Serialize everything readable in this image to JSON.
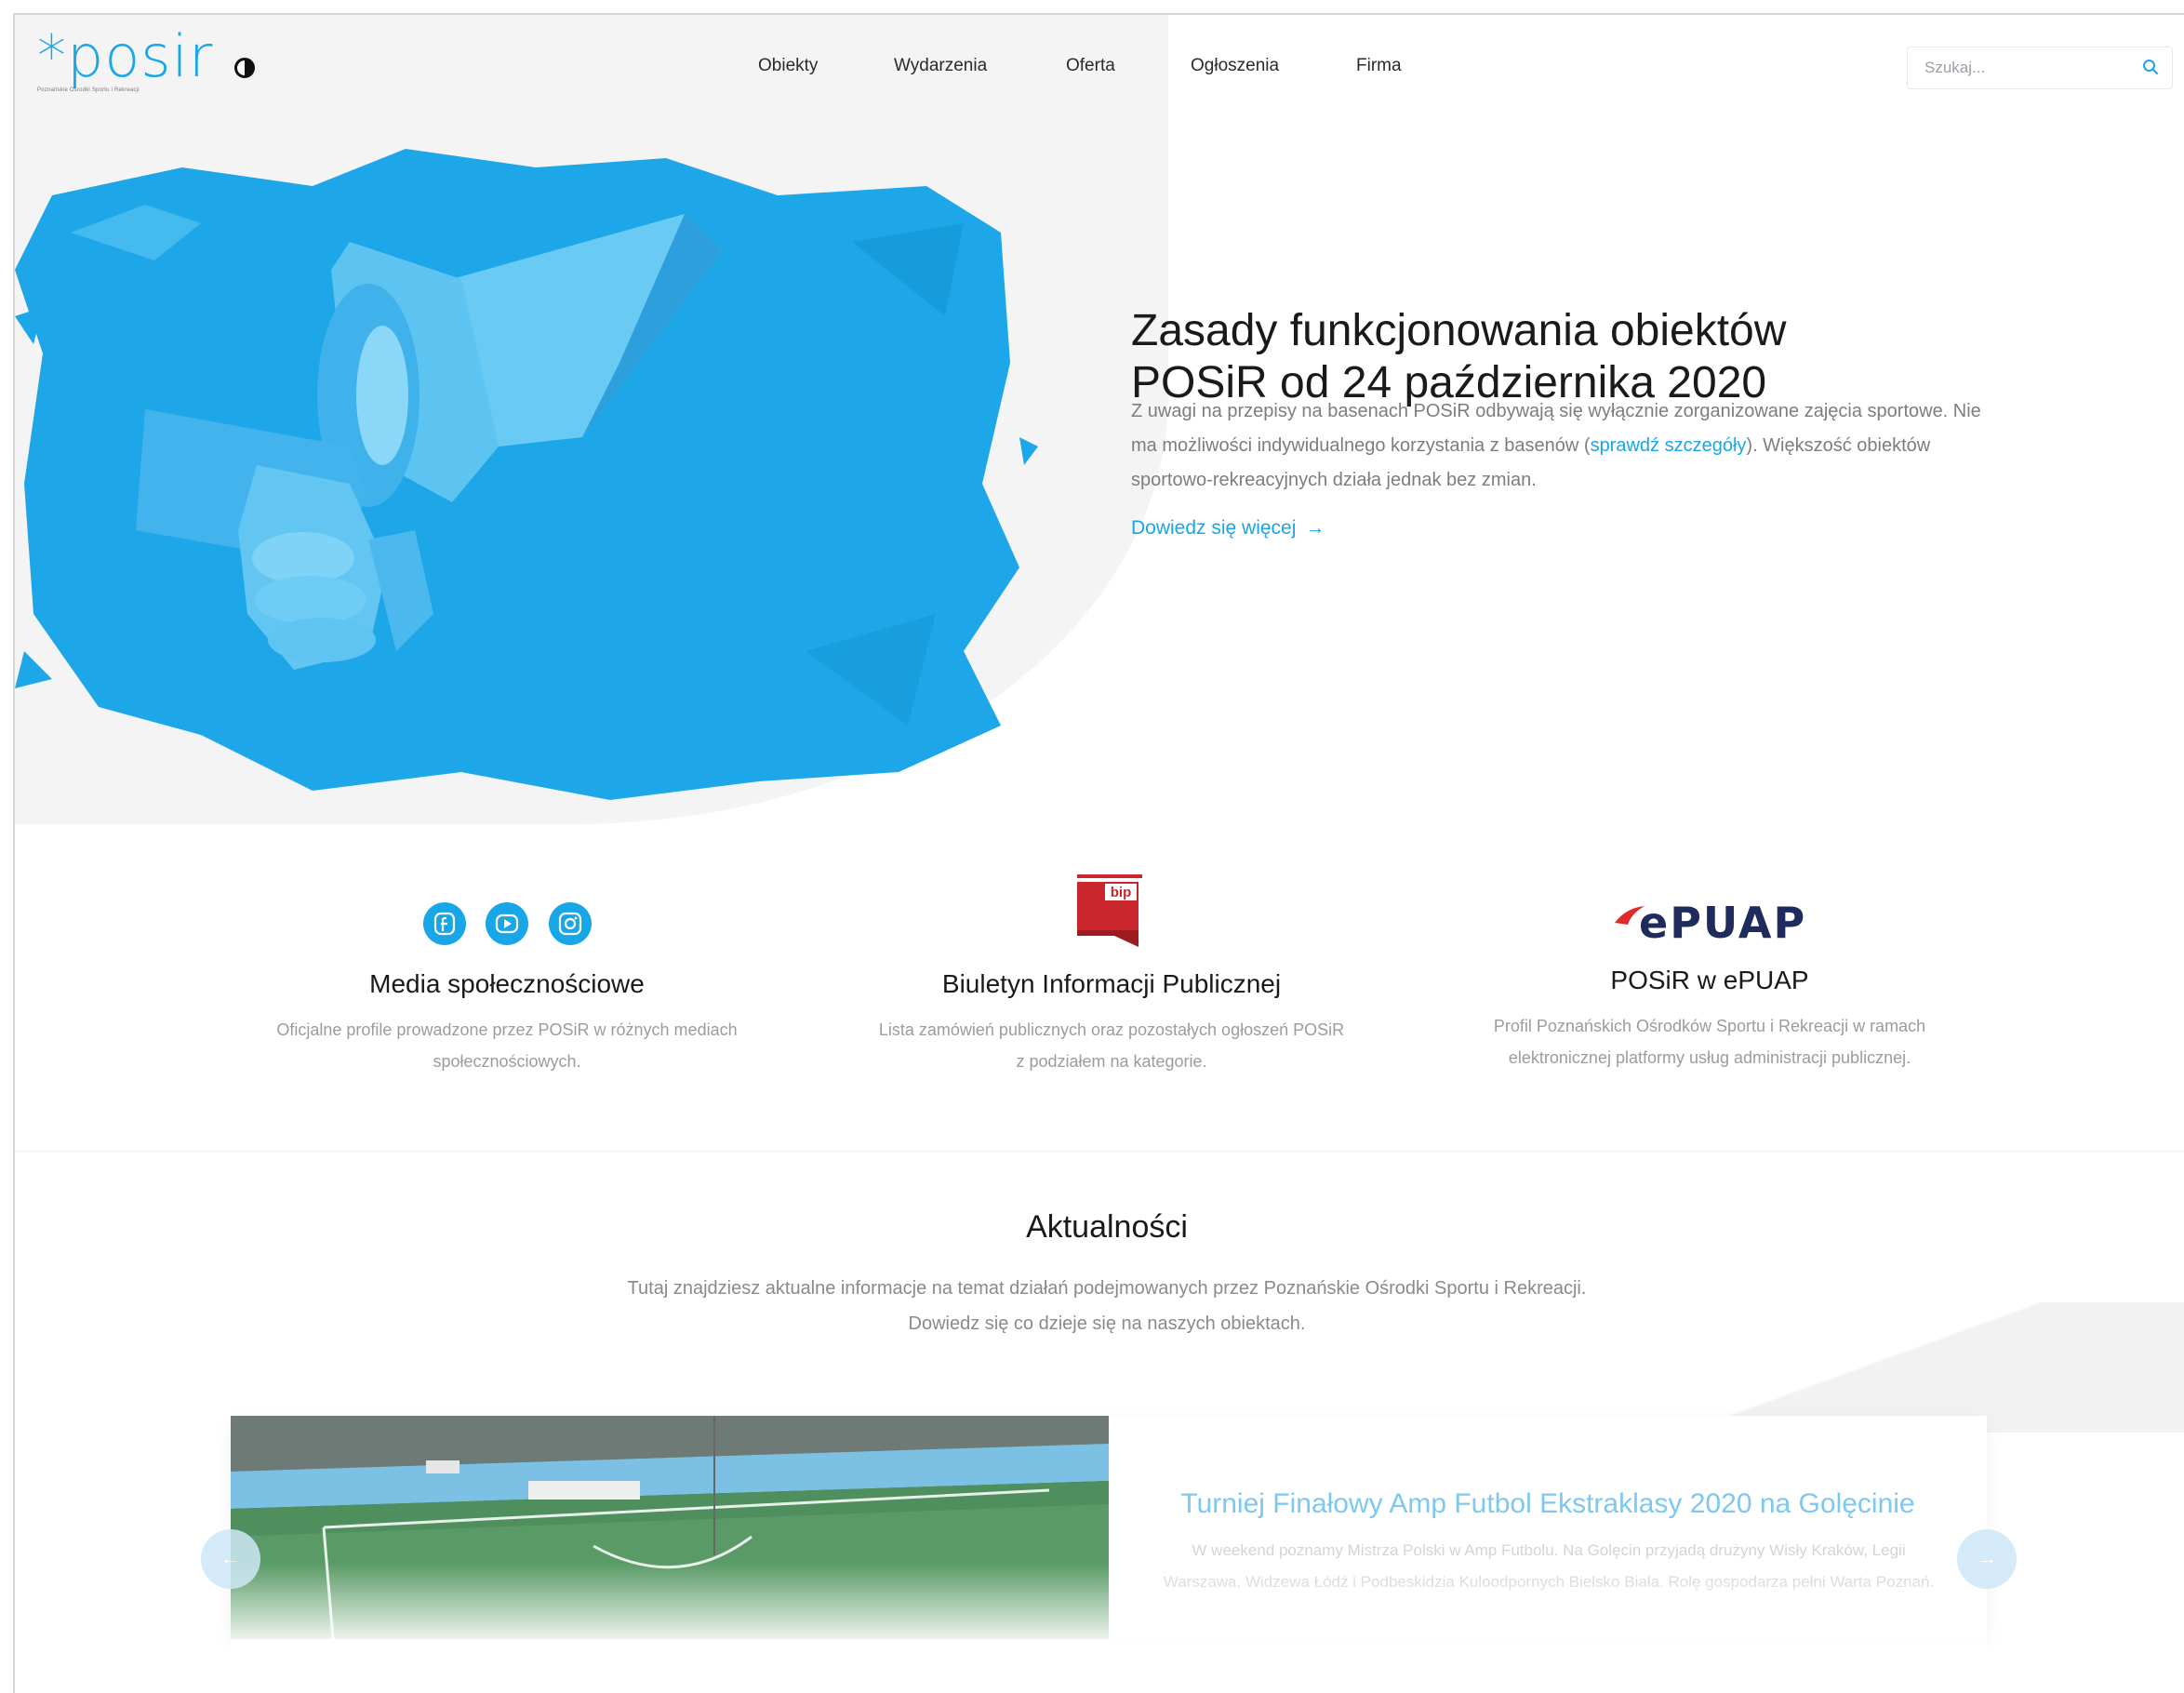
{
  "header": {
    "logo_text": "*posir",
    "logo_tagline": "Poznańskie Ośrodki Sportu i Rekreacji",
    "nav": [
      "Obiekty",
      "Wydarzenia",
      "Oferta",
      "Ogłoszenia",
      "Firma"
    ],
    "search_placeholder": "Szukaj..."
  },
  "hero": {
    "title_line1": "Zasady funkcjonowania obiektów",
    "title_line2": "POSiR od 24 października 2020",
    "text_part1": "Z uwagi na przepisy na basenach POSiR odbywają się wyłącznie zorganizowane zajęcia sportowe. Nie ma możliwości indywidualnego korzystania z basenów (",
    "text_link": "sprawdź szczegóły",
    "text_part2": "). Większość obiektów sportowo-rekreacyjnych działa jednak bez zmian.",
    "more_label": "Dowiedz się więcej",
    "more_arrow": "→"
  },
  "features": [
    {
      "title": "Media społecznościowe",
      "line1": "Oficjalne profile prowadzone przez POSiR w różnych mediach",
      "line2": "społecznościowych."
    },
    {
      "title": "Biuletyn Informacji Publicznej",
      "logo_text": "bip",
      "line1": "Lista zamówień publicznych oraz pozostałych ogłoszeń POSiR",
      "line2": "z podziałem na kategorie."
    },
    {
      "title": "POSiR w ePUAP",
      "logo_text": "ePUAP",
      "line1": "Profil Poznańskich Ośrodków Sportu i Rekreacji w ramach",
      "line2": "elektronicznej platformy usług administracji publicznej."
    }
  ],
  "social_icons": [
    "facebook-icon",
    "youtube-icon",
    "instagram-icon"
  ],
  "news": {
    "heading": "Aktualności",
    "sub_line1": "Tutaj znajdziesz aktualne informacje na temat działań podejmowanych przez Poznańskie Ośrodki Sportu i Rekreacji.",
    "sub_line2": "Dowiedz się co dzieje się na naszych obiektach.",
    "card_title": "Turniej Finałowy Amp Futbol Ekstraklasy 2020 na Golęcinie",
    "card_text": "W weekend poznamy Mistrza Polski w Amp Futbolu. Na Golęcin przyjadą drużyny Wisły Kraków, Legii Warszawa, Widzewa Łódź i Podbeskidzia Kuloodpornych Bielsko Biała. Rolę gospodarza pełni Warta Poznań.",
    "prev_arrow": "←",
    "next_arrow": "→"
  },
  "colors": {
    "accent": "#19a6e6",
    "bip_red": "#c8262c",
    "epuap_navy": "#1f2b5c",
    "epuap_red": "#e02a2a"
  }
}
